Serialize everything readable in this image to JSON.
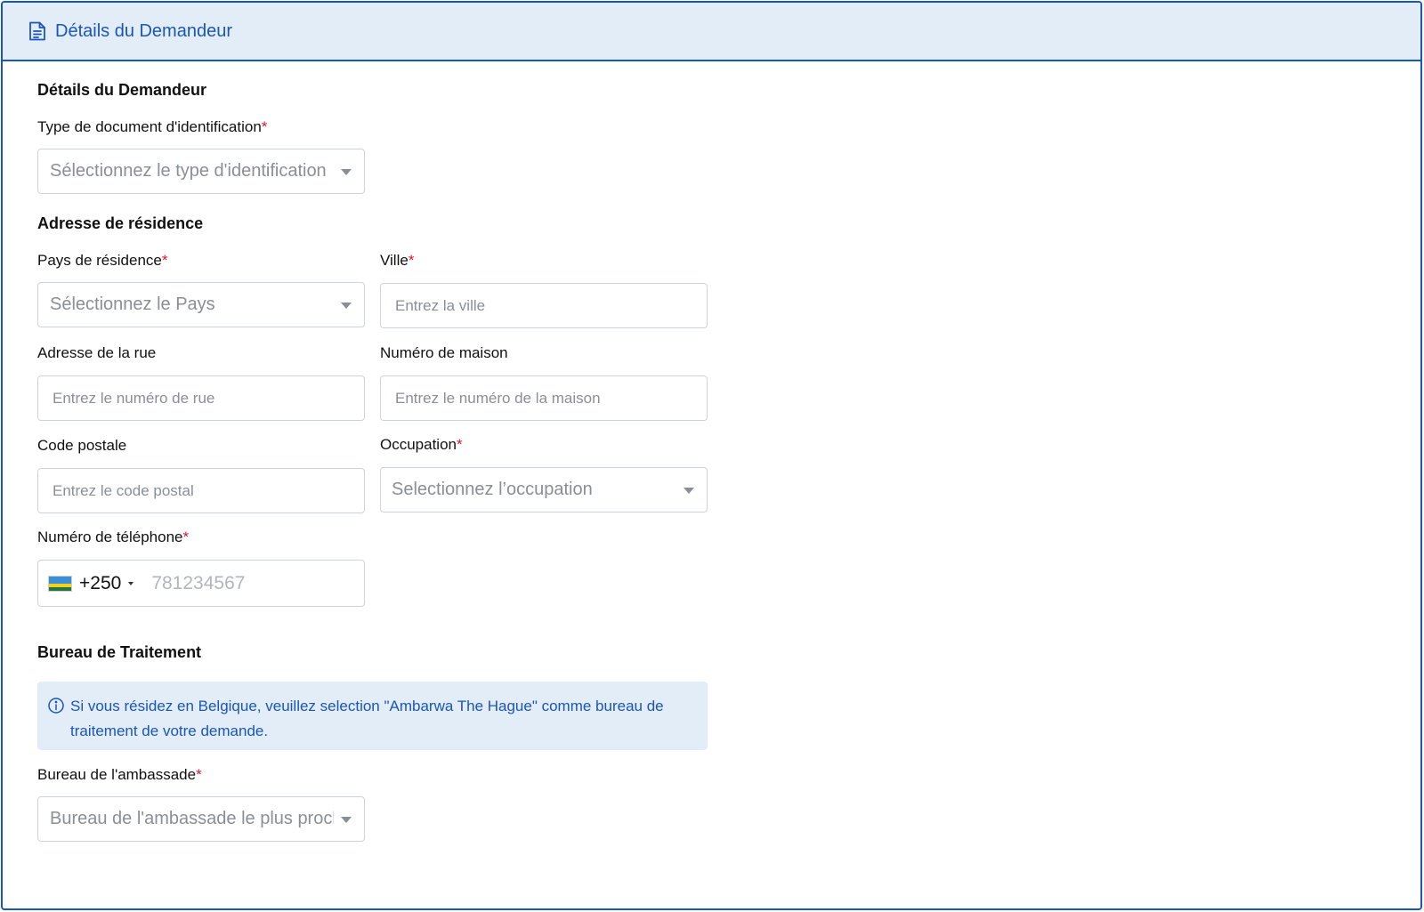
{
  "header": {
    "title": "Détails du Demandeur",
    "icon": "document-icon"
  },
  "colors": {
    "accent": "#1a56b8",
    "header_bg": "#e3edf8",
    "required": "#e0162b",
    "border": "#cfd4da"
  },
  "applicant": {
    "section_title": "Détails du Demandeur",
    "id_type": {
      "label": "Type de document d'identification",
      "required_mark": "*",
      "placeholder": "Sélectionnez le type d'identification"
    }
  },
  "residence": {
    "section_title": "Adresse de résidence",
    "country": {
      "label": "Pays de résidence",
      "required_mark": "*",
      "placeholder": "Sélectionnez le Pays"
    },
    "city": {
      "label": "Ville",
      "required_mark": "*",
      "placeholder": "Entrez la ville"
    },
    "street": {
      "label": "Adresse de la rue",
      "placeholder": "Entrez le numéro de rue"
    },
    "house": {
      "label": "Numéro de maison",
      "placeholder": "Entrez le numéro de la maison"
    },
    "postal": {
      "label": "Code postale",
      "placeholder": "Entrez le code postal"
    },
    "occupation": {
      "label": "Occupation",
      "required_mark": "*",
      "placeholder": "Selectionnez l’occupation"
    },
    "phone": {
      "label": "Numéro de téléphone",
      "required_mark": "*",
      "country_code": "+250",
      "flag": "rwanda-flag-icon",
      "placeholder": "781234567"
    }
  },
  "processing": {
    "section_title": "Bureau de Traitement",
    "info_message": "Si vous résidez en Belgique, veuillez selection \"Ambarwa The Hague\" comme bureau de traitement de votre demande.",
    "embassy": {
      "label": "Bureau de l'ambassade",
      "required_mark": "*",
      "placeholder": "Bureau de l'ambassade le plus proche"
    }
  }
}
